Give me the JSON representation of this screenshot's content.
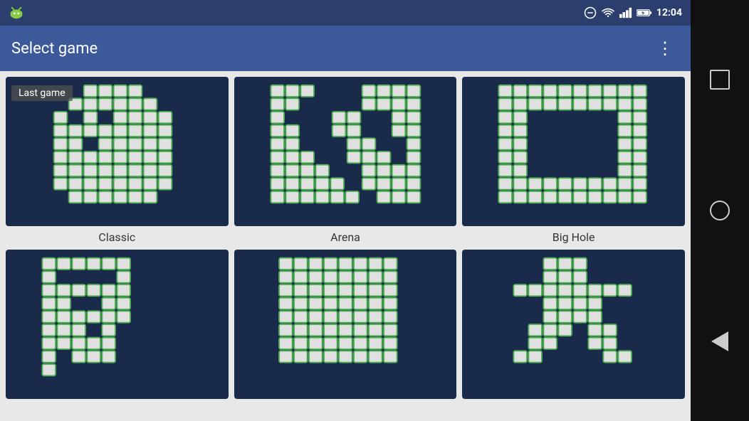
{
  "status_bar": {
    "time": "12:04",
    "icons": [
      "signal",
      "wifi",
      "battery"
    ]
  },
  "app_bar": {
    "title": "Select game",
    "more_icon": "⋮"
  },
  "games": [
    {
      "id": "classic",
      "label": "Classic",
      "is_last": true,
      "last_label": "Last game"
    },
    {
      "id": "arena",
      "label": "Arena",
      "is_last": false,
      "last_label": ""
    },
    {
      "id": "big-hole",
      "label": "Big Hole",
      "is_last": false,
      "last_label": ""
    },
    {
      "id": "game4",
      "label": "",
      "is_last": false,
      "last_label": ""
    },
    {
      "id": "game5",
      "label": "",
      "is_last": false,
      "last_label": ""
    },
    {
      "id": "game6",
      "label": "",
      "is_last": false,
      "last_label": ""
    }
  ],
  "nav": {
    "square_label": "recent-apps",
    "circle_label": "home",
    "triangle_label": "back"
  }
}
